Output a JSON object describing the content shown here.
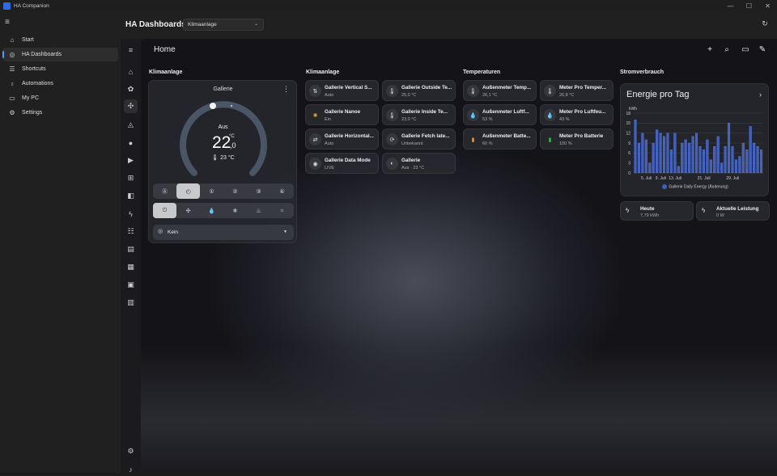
{
  "window": {
    "title": "HA Companion",
    "controls": [
      "—",
      "☐",
      "✕"
    ]
  },
  "nav": {
    "items": [
      {
        "label": "Start",
        "icon": "home-outline-icon"
      },
      {
        "label": "HA Dashboards",
        "icon": "globe-icon",
        "active": true
      },
      {
        "label": "Shortcuts",
        "icon": "list-icon"
      },
      {
        "label": "Automations",
        "icon": "lightbulb-icon"
      },
      {
        "label": "My PC",
        "icon": "laptop-icon"
      },
      {
        "label": "Settings",
        "icon": "gear-icon"
      }
    ]
  },
  "header": {
    "title": "HA Dashboards",
    "dashboard_select": "Klimaanlage"
  },
  "main": {
    "title": "Home"
  },
  "sections": {
    "climate": "Klimaanlage",
    "entities": "Klimaanlage",
    "temps": "Temperaturen",
    "power": "Stromverbrauch"
  },
  "thermostat": {
    "name": "Gallerie",
    "state": "Aus",
    "target": "22",
    "unit": "°C",
    "decimal": ",0",
    "current": "🌡 23 °C",
    "target_fraction": 0.5,
    "presets_label": "Kein"
  },
  "entity_tiles": [
    {
      "name": "Gallerie Vertical S...",
      "state": "Auto",
      "icon": "arrows-vertical-icon",
      "glyph": "⇅"
    },
    {
      "name": "Gallerie Outside Te...",
      "state": "25,0 °C",
      "icon": "thermometer-icon",
      "glyph": "🌡"
    },
    {
      "name": "Gallerie Nanoe",
      "state": "Ein",
      "icon": "sparkle-icon",
      "glyph": "✺",
      "accent": "#d3a629"
    },
    {
      "name": "Gallerie Inside Te...",
      "state": "23,0 °C",
      "icon": "thermometer-icon",
      "glyph": "🌡"
    },
    {
      "name": "Gallerie Horizontal...",
      "state": "Auto",
      "icon": "arrows-horizontal-icon",
      "glyph": "⇄"
    },
    {
      "name": "Gallerie Fetch late...",
      "state": "Unbekannt",
      "icon": "clock-refresh-icon",
      "glyph": "⟳"
    },
    {
      "name": "Gallerie Data Mode",
      "state": "LIVE",
      "icon": "eye-icon",
      "glyph": "◉"
    },
    {
      "name": "Gallerie",
      "state": "Aus · 23 °C",
      "icon": "thermostat-icon",
      "glyph": "◐"
    }
  ],
  "temp_tiles": [
    {
      "name": "Außenmeter Temp...",
      "state": "26,1 °C",
      "icon": "thermometer-icon",
      "glyph": "🌡"
    },
    {
      "name": "Meter Pro Temper...",
      "state": "26,8 °C",
      "icon": "thermometer-icon",
      "glyph": "🌡"
    },
    {
      "name": "Außenmeter Luftf...",
      "state": "53 %",
      "icon": "water-drop-icon",
      "glyph": "💧"
    },
    {
      "name": "Meter Pro Luftfeu...",
      "state": "43 %",
      "icon": "water-drop-icon",
      "glyph": "💧"
    },
    {
      "name": "Außenmeter Batte...",
      "state": "60 %",
      "icon": "battery-icon",
      "glyph": "▮",
      "accent": "#e39a1c"
    },
    {
      "name": "Meter Pro Batterie",
      "state": "100 %",
      "icon": "battery-full-icon",
      "glyph": "▮",
      "accent": "#35b54a"
    }
  ],
  "energy": {
    "title": "Energie pro Tag",
    "legend": "Gallerie Daily Energy (Änderung)"
  },
  "chart_data": {
    "type": "bar",
    "title": "Energie pro Tag",
    "ylabel": "kWh",
    "ylim": [
      0,
      18
    ],
    "yticks": [
      0,
      3,
      6,
      9,
      12,
      15,
      18
    ],
    "xtick_labels": [
      "5. Juli",
      "9. Juli",
      "13. Juli",
      "21. Juli",
      "29. Juli"
    ],
    "series": [
      {
        "name": "Gallerie Daily Energy (Änderung)",
        "color": "#3f5fc2",
        "values": [
          16,
          9,
          12,
          10,
          3,
          9,
          13,
          12,
          11,
          12,
          7,
          12,
          2,
          9,
          10,
          9,
          11,
          12,
          8,
          7,
          10,
          4,
          8,
          11,
          3,
          8,
          15,
          8,
          4,
          5,
          9,
          7,
          14,
          9,
          8,
          7
        ]
      }
    ]
  },
  "power_tiles": [
    {
      "name": "Heute",
      "state": "7,79 kWh",
      "icon": "lightning-icon",
      "glyph": "⚡"
    },
    {
      "name": "Aktuelle Leistung",
      "state": "0 W",
      "icon": "lightning-icon",
      "glyph": "⚡"
    }
  ]
}
